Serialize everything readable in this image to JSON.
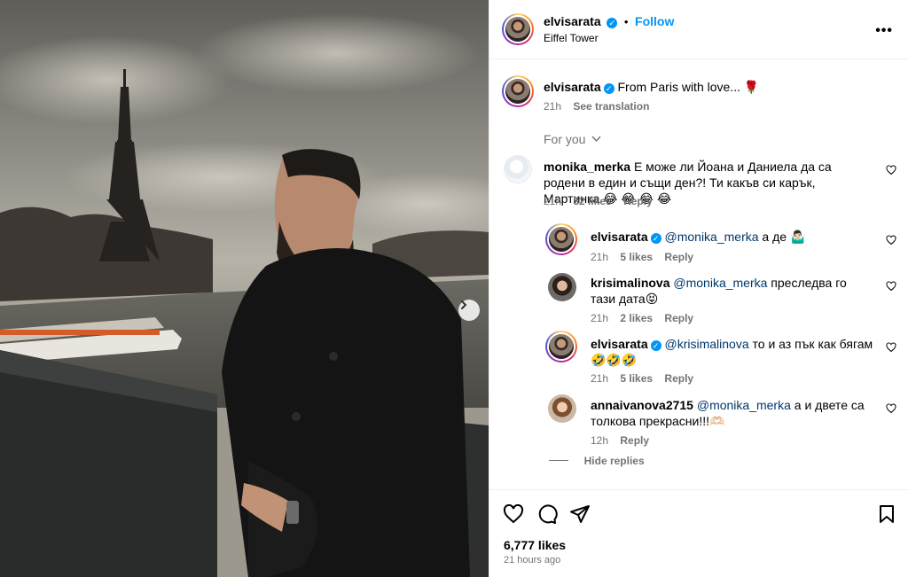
{
  "post": {
    "author": "elvisarata",
    "follow_label": "Follow",
    "location": "Eiffel Tower",
    "more_label": "•••"
  },
  "caption": {
    "author": "elvisarata",
    "text": "From Paris with love... 🌹",
    "time": "21h",
    "see_translation": "See translation"
  },
  "for_you": "For you",
  "comments": [
    {
      "author": "monika_merka",
      "text": "Е може ли Йоана и Даниела да са родени в един и същи ден?! Ти какъв си карък, Мартинка 😂 😂 😂 😂",
      "time": "21h",
      "likes": "32 likes",
      "reply": "Reply"
    }
  ],
  "replies": [
    {
      "author": "elvisarata",
      "mention": "@monika_merka",
      "text": " а де 🤷🏻‍♂️",
      "time": "21h",
      "likes": "5 likes",
      "reply": "Reply"
    },
    {
      "author": "krisimalinova",
      "mention": "@monika_merka",
      "text": " преследва го тази дата😝",
      "time": "21h",
      "likes": "2 likes",
      "reply": "Reply"
    },
    {
      "author": "elvisarata",
      "mention": "@krisimalinova",
      "text": " то и аз пък как бягам 🤣🤣🤣",
      "time": "21h",
      "likes": "5 likes",
      "reply": "Reply"
    },
    {
      "author": "annaivanova2715",
      "mention": "@monika_merka",
      "text": " а и двете са толкова прекрасни!!!🫶🏻",
      "time": "12h",
      "likes": "",
      "reply": "Reply"
    }
  ],
  "hide_replies": "Hide replies",
  "footer": {
    "likes": "6,777 likes",
    "time": "21 hours ago"
  },
  "icons": {
    "verified": "verified-badge-icon",
    "like": "heart-icon",
    "comment": "comment-bubble-icon",
    "share": "paper-plane-icon",
    "save": "bookmark-icon",
    "next": "chevron-right-icon"
  },
  "colors": {
    "accent": "#0095f6",
    "muted": "#737373",
    "mention": "#00376b"
  }
}
